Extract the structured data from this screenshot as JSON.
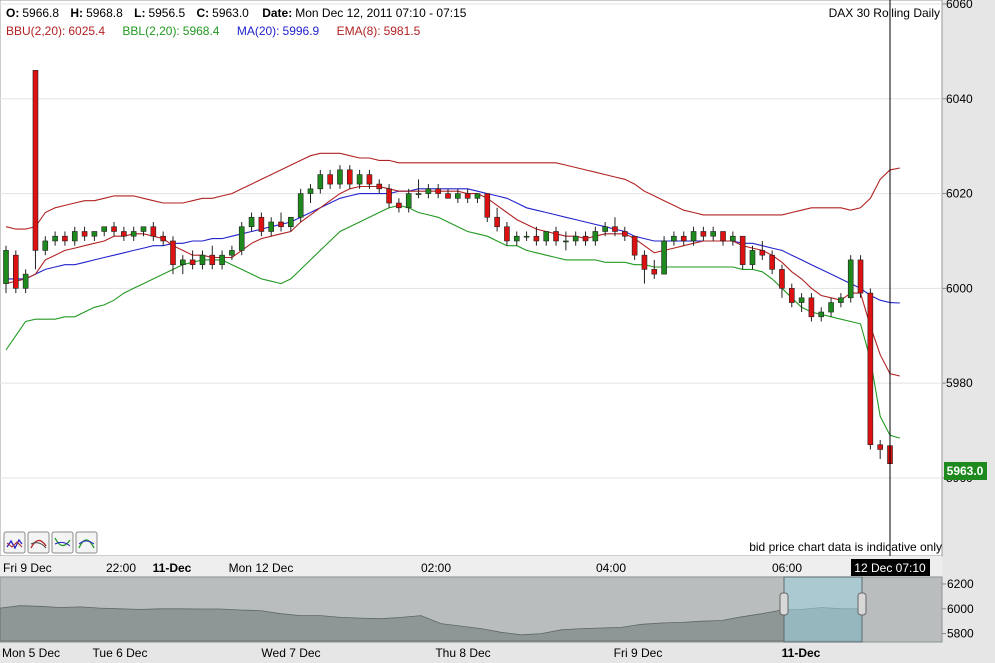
{
  "header": {
    "ohlc": [
      {
        "label": "O:",
        "value": "5966.8"
      },
      {
        "label": "H:",
        "value": "5968.8"
      },
      {
        "label": "L:",
        "value": "5956.5"
      },
      {
        "label": "C:",
        "value": "5963.0"
      }
    ],
    "date_label": "Date:",
    "date_value": "Mon Dec 12, 2011 07:10 - 07:15",
    "instrument": "DAX 30  Rolling Daily",
    "indicators": [
      {
        "label": "BBU(2,20):",
        "value": "6025.4",
        "color": "#b22222"
      },
      {
        "label": "BBL(2,20):",
        "value": "5968.4",
        "color": "#229922"
      },
      {
        "label": "MA(20):",
        "value": "5996.9",
        "color": "#2222cc"
      },
      {
        "label": "EMA(8):",
        "value": "5981.5",
        "color": "#b22222"
      }
    ]
  },
  "notice": "bid price chart data is indicative only",
  "last_price": "5963.0",
  "crosshair_label": "12 Dec 07:10",
  "toolbar_icons": [
    "chart-style-icon-1",
    "chart-style-icon-2",
    "chart-style-icon-3",
    "chart-style-icon-4"
  ],
  "colors": {
    "up": "#1e8a1e",
    "down": "#dd1111",
    "bbu": "#b22222",
    "bbl": "#229922",
    "ma": "#2222cc",
    "ema": "#b22222",
    "last_badge": "#1e8a1e"
  },
  "chart_data": {
    "type": "candlestick",
    "title": "DAX 30  Rolling Daily",
    "y_axis": {
      "side": "right",
      "range": [
        5945,
        6060
      ],
      "ticks": [
        5960,
        5980,
        6000,
        6020,
        6040,
        6060
      ]
    },
    "x_axis": {
      "labels": [
        {
          "text": "Fri 9 Dec",
          "bold": false
        },
        {
          "text": "22:00",
          "bold": false
        },
        {
          "text": "11-Dec",
          "bold": true
        },
        {
          "text": "Mon 12 Dec",
          "bold": false
        },
        {
          "text": "02:00",
          "bold": false
        },
        {
          "text": "04:00",
          "bold": false
        },
        {
          "text": "06:00",
          "bold": false
        }
      ]
    },
    "candles": [
      {
        "o": 6001,
        "h": 6009,
        "l": 5999,
        "c": 6008
      },
      {
        "o": 6007,
        "h": 6008,
        "l": 5999,
        "c": 6000
      },
      {
        "o": 6000,
        "h": 6004,
        "l": 5999,
        "c": 6003
      },
      {
        "o": 6046,
        "h": 6046,
        "l": 6004,
        "c": 6008
      },
      {
        "o": 6008,
        "h": 6011,
        "l": 6007,
        "c": 6010
      },
      {
        "o": 6010,
        "h": 6012,
        "l": 6009,
        "c": 6011
      },
      {
        "o": 6011,
        "h": 6012,
        "l": 6009,
        "c": 6010
      },
      {
        "o": 6010,
        "h": 6013,
        "l": 6009,
        "c": 6012
      },
      {
        "o": 6012,
        "h": 6013,
        "l": 6010,
        "c": 6011
      },
      {
        "o": 6011,
        "h": 6012,
        "l": 6010,
        "c": 6012
      },
      {
        "o": 6012,
        "h": 6013,
        "l": 6011,
        "c": 6013
      },
      {
        "o": 6013,
        "h": 6014,
        "l": 6011,
        "c": 6012
      },
      {
        "o": 6012,
        "h": 6013,
        "l": 6010,
        "c": 6011
      },
      {
        "o": 6011,
        "h": 6013,
        "l": 6010,
        "c": 6012
      },
      {
        "o": 6012,
        "h": 6013,
        "l": 6011,
        "c": 6013
      },
      {
        "o": 6013,
        "h": 6014,
        "l": 6010,
        "c": 6011
      },
      {
        "o": 6011,
        "h": 6012,
        "l": 6009,
        "c": 6010
      },
      {
        "o": 6010,
        "h": 6011,
        "l": 6003,
        "c": 6005
      },
      {
        "o": 6005,
        "h": 6007,
        "l": 6003,
        "c": 6006
      },
      {
        "o": 6006,
        "h": 6008,
        "l": 6004,
        "c": 6005
      },
      {
        "o": 6005,
        "h": 6008,
        "l": 6004,
        "c": 6007
      },
      {
        "o": 6007,
        "h": 6009,
        "l": 6004,
        "c": 6005
      },
      {
        "o": 6005,
        "h": 6008,
        "l": 6004,
        "c": 6007
      },
      {
        "o": 6007,
        "h": 6009,
        "l": 6006,
        "c": 6008
      },
      {
        "o": 6008,
        "h": 6014,
        "l": 6007,
        "c": 6013
      },
      {
        "o": 6013,
        "h": 6016,
        "l": 6012,
        "c": 6015
      },
      {
        "o": 6015,
        "h": 6016,
        "l": 6011,
        "c": 6012
      },
      {
        "o": 6012,
        "h": 6015,
        "l": 6011,
        "c": 6014
      },
      {
        "o": 6014,
        "h": 6016,
        "l": 6012,
        "c": 6013
      },
      {
        "o": 6013,
        "h": 6015,
        "l": 6012,
        "c": 6015
      },
      {
        "o": 6015,
        "h": 6021,
        "l": 6014,
        "c": 6020
      },
      {
        "o": 6020,
        "h": 6022,
        "l": 6018,
        "c": 6021
      },
      {
        "o": 6021,
        "h": 6025,
        "l": 6020,
        "c": 6024
      },
      {
        "o": 6024,
        "h": 6025,
        "l": 6021,
        "c": 6022
      },
      {
        "o": 6022,
        "h": 6026,
        "l": 6021,
        "c": 6025
      },
      {
        "o": 6025,
        "h": 6026,
        "l": 6021,
        "c": 6022
      },
      {
        "o": 6022,
        "h": 6025,
        "l": 6021,
        "c": 6024
      },
      {
        "o": 6024,
        "h": 6025,
        "l": 6021,
        "c": 6022
      },
      {
        "o": 6022,
        "h": 6023,
        "l": 6020,
        "c": 6021
      },
      {
        "o": 6021,
        "h": 6022,
        "l": 6017,
        "c": 6018
      },
      {
        "o": 6018,
        "h": 6019,
        "l": 6016,
        "c": 6017
      },
      {
        "o": 6017,
        "h": 6021,
        "l": 6016,
        "c": 6020
      },
      {
        "o": 6020,
        "h": 6023,
        "l": 6019,
        "c": 6020
      },
      {
        "o": 6020,
        "h": 6022,
        "l": 6019,
        "c": 6021
      },
      {
        "o": 6021,
        "h": 6022,
        "l": 6019,
        "c": 6020
      },
      {
        "o": 6020,
        "h": 6021,
        "l": 6019,
        "c": 6019
      },
      {
        "o": 6019,
        "h": 6021,
        "l": 6018,
        "c": 6020
      },
      {
        "o": 6020,
        "h": 6021,
        "l": 6018,
        "c": 6019
      },
      {
        "o": 6019,
        "h": 6020,
        "l": 6018,
        "c": 6020
      },
      {
        "o": 6020,
        "h": 6020,
        "l": 6014,
        "c": 6015
      },
      {
        "o": 6015,
        "h": 6017,
        "l": 6012,
        "c": 6013
      },
      {
        "o": 6013,
        "h": 6014,
        "l": 6009,
        "c": 6010
      },
      {
        "o": 6010,
        "h": 6012,
        "l": 6009,
        "c": 6011
      },
      {
        "o": 6011,
        "h": 6012,
        "l": 6010,
        "c": 6011
      },
      {
        "o": 6011,
        "h": 6013,
        "l": 6009,
        "c": 6010
      },
      {
        "o": 6010,
        "h": 6012,
        "l": 6009,
        "c": 6012
      },
      {
        "o": 6012,
        "h": 6013,
        "l": 6009,
        "c": 6010
      },
      {
        "o": 6010,
        "h": 6012,
        "l": 6008,
        "c": 6010
      },
      {
        "o": 6010,
        "h": 6012,
        "l": 6009,
        "c": 6011
      },
      {
        "o": 6011,
        "h": 6012,
        "l": 6009,
        "c": 6010
      },
      {
        "o": 6010,
        "h": 6013,
        "l": 6009,
        "c": 6012
      },
      {
        "o": 6012,
        "h": 6014,
        "l": 6011,
        "c": 6013
      },
      {
        "o": 6013,
        "h": 6015,
        "l": 6011,
        "c": 6012
      },
      {
        "o": 6012,
        "h": 6013,
        "l": 6010,
        "c": 6011
      },
      {
        "o": 6011,
        "h": 6011,
        "l": 6006,
        "c": 6007
      },
      {
        "o": 6007,
        "h": 6008,
        "l": 6001,
        "c": 6004
      },
      {
        "o": 6004,
        "h": 6006,
        "l": 6002,
        "c": 6003
      },
      {
        "o": 6003,
        "h": 6011,
        "l": 6003,
        "c": 6010
      },
      {
        "o": 6010,
        "h": 6012,
        "l": 6009,
        "c": 6011
      },
      {
        "o": 6011,
        "h": 6012,
        "l": 6009,
        "c": 6010
      },
      {
        "o": 6010,
        "h": 6013,
        "l": 6009,
        "c": 6012
      },
      {
        "o": 6012,
        "h": 6013,
        "l": 6010,
        "c": 6011
      },
      {
        "o": 6011,
        "h": 6013,
        "l": 6010,
        "c": 6012
      },
      {
        "o": 6012,
        "h": 6012,
        "l": 6009,
        "c": 6010
      },
      {
        "o": 6010,
        "h": 6012,
        "l": 6009,
        "c": 6011
      },
      {
        "o": 6011,
        "h": 6011,
        "l": 6004,
        "c": 6005
      },
      {
        "o": 6005,
        "h": 6009,
        "l": 6004,
        "c": 6008
      },
      {
        "o": 6008,
        "h": 6010,
        "l": 6006,
        "c": 6007
      },
      {
        "o": 6007,
        "h": 6008,
        "l": 6003,
        "c": 6004
      },
      {
        "o": 6004,
        "h": 6005,
        "l": 5998,
        "c": 6000
      },
      {
        "o": 6000,
        "h": 6001,
        "l": 5996,
        "c": 5997
      },
      {
        "o": 5997,
        "h": 5999,
        "l": 5995,
        "c": 5998
      },
      {
        "o": 5998,
        "h": 5999,
        "l": 5993,
        "c": 5994
      },
      {
        "o": 5994,
        "h": 5996,
        "l": 5993,
        "c": 5995
      },
      {
        "o": 5995,
        "h": 5998,
        "l": 5994,
        "c": 5997
      },
      {
        "o": 5997,
        "h": 5999,
        "l": 5996,
        "c": 5998
      },
      {
        "o": 5998,
        "h": 6007,
        "l": 5997,
        "c": 6006
      },
      {
        "o": 6006,
        "h": 6007,
        "l": 5998,
        "c": 5999
      },
      {
        "o": 5999,
        "h": 6000,
        "l": 5966,
        "c": 5967
      },
      {
        "o": 5967,
        "h": 5968,
        "l": 5964,
        "c": 5966
      },
      {
        "o": 5966.8,
        "h": 5968.8,
        "l": 5956.5,
        "c": 5963.0
      }
    ],
    "series": [
      {
        "name": "BBU(2,20)",
        "color": "#b22222",
        "values": [
          6013,
          6012.5,
          6012.5,
          6013,
          6016,
          6017,
          6017.5,
          6018,
          6018.5,
          6018.5,
          6019,
          6019.5,
          6019.5,
          6019.5,
          6019,
          6018.5,
          6018,
          6018,
          6018,
          6018.5,
          6019,
          6019,
          6019.5,
          6020,
          6021,
          6022,
          6023,
          6024,
          6025,
          6026,
          6027,
          6028,
          6028.5,
          6028.5,
          6028.5,
          6028,
          6027.5,
          6027.5,
          6027,
          6027,
          6026.5,
          6026.5,
          6026.5,
          6026.5,
          6026.5,
          6026.5,
          6026.5,
          6026.5,
          6026.5,
          6026.5,
          6026.5,
          6026.5,
          6026.5,
          6026.5,
          6026.5,
          6026.5,
          6026.5,
          6026,
          6025.5,
          6025,
          6024.5,
          6024,
          6023.5,
          6023,
          6022,
          6020.5,
          6019.5,
          6018.5,
          6017.5,
          6016.5,
          6016,
          6015.5,
          6015.5,
          6015.5,
          6015.5,
          6015.5,
          6015.5,
          6015.5,
          6015.5,
          6015.5,
          6016,
          6016.5,
          6017,
          6017,
          6017,
          6017,
          6016.5,
          6017,
          6019,
          6023,
          6025,
          6025.4
        ]
      },
      {
        "name": "MA(20)",
        "color": "#2222cc",
        "values": [
          6002,
          6002,
          6002,
          6003,
          6004,
          6004.5,
          6005,
          6005,
          6005.5,
          6006,
          6006.5,
          6007,
          6007.5,
          6008,
          6008.5,
          6009,
          6009,
          6009.5,
          6009.5,
          6010,
          6010,
          6010.5,
          6010.5,
          6011,
          6011.5,
          6012,
          6012.5,
          6013,
          6013.5,
          6014,
          6015,
          6016,
          6017,
          6018,
          6019,
          6019.5,
          6020,
          6020,
          6020,
          6020,
          6020.5,
          6020.5,
          6021,
          6021,
          6021,
          6021,
          6021,
          6021,
          6020.5,
          6020,
          6019.5,
          6019,
          6018,
          6017,
          6016.5,
          6016,
          6015.5,
          6015,
          6014.5,
          6014,
          6013.5,
          6013,
          6012.5,
          6012,
          6011,
          6010.5,
          6010,
          6010,
          6010,
          6010,
          6010,
          6010,
          6010,
          6010,
          6010,
          6009.5,
          6009.5,
          6009,
          6008.5,
          6008,
          6007,
          6006,
          6005,
          6004,
          6003,
          6002,
          6001,
          6000,
          5998.5,
          5997.5,
          5997,
          5996.9
        ]
      },
      {
        "name": "BBL(2,20)",
        "color": "#229922",
        "values": [
          5987,
          5990,
          5993,
          5993.5,
          5993.5,
          5993.5,
          5994,
          5994,
          5995,
          5996,
          5996.5,
          5997.5,
          5999,
          6000,
          6001,
          6002,
          6003,
          6004,
          6005,
          6005.5,
          6006,
          6006,
          6006,
          6005,
          6004,
          6003,
          6002,
          6001.5,
          6001,
          6002,
          6004,
          6006,
          6008,
          6010,
          6012,
          6013,
          6014,
          6015,
          6016,
          6017,
          6017.5,
          6017,
          6016,
          6015.5,
          6015,
          6014,
          6013,
          6012,
          6011.5,
          6011,
          6010,
          6009,
          6009,
          6008,
          6007.5,
          6007,
          6006.5,
          6006,
          6006,
          6006,
          6006,
          6005.5,
          6005.5,
          6005.5,
          6005,
          6005,
          6004.5,
          6004.5,
          6004.5,
          6004.5,
          6004.5,
          6004.5,
          6004.5,
          6004.5,
          6004.5,
          6004,
          6004,
          6003.5,
          6002,
          6000,
          5998,
          5996,
          5995,
          5994.5,
          5994,
          5993.5,
          5993,
          5992.5,
          5985,
          5973,
          5969,
          5968.4
        ]
      },
      {
        "name": "EMA(8)",
        "color": "#b22222",
        "values": [
          6001,
          6001.5,
          6002,
          6003,
          6006,
          6007,
          6008,
          6008.5,
          6009,
          6009.5,
          6010,
          6011,
          6011,
          6011.5,
          6011.5,
          6011,
          6010.5,
          6009,
          6008,
          6007,
          6007,
          6006.5,
          6006.5,
          6006.5,
          6008,
          6009.5,
          6010.5,
          6011,
          6011.5,
          6012,
          6014,
          6015.5,
          6017,
          6018.5,
          6020,
          6021,
          6021.5,
          6021.5,
          6021.5,
          6021,
          6020.5,
          6020.5,
          6020.5,
          6020.5,
          6020.5,
          6020.5,
          6020.5,
          6020,
          6020,
          6019,
          6017.5,
          6016,
          6014.5,
          6013.5,
          6012.5,
          6012,
          6011.5,
          6011,
          6011,
          6010.5,
          6011,
          6011.5,
          6011.5,
          6011.5,
          6010.5,
          6009,
          6007.5,
          6008,
          6008.5,
          6009,
          6009.5,
          6010,
          6010,
          6010,
          6010,
          6009,
          6008.5,
          6008,
          6007,
          6005.5,
          6003.5,
          6002,
          6000,
          5998.5,
          5998,
          5997.5,
          5999,
          5999,
          5992,
          5986,
          5982,
          5981.5
        ]
      }
    ]
  },
  "navigator": {
    "labels": [
      "Mon 5 Dec",
      "Tue 6 Dec",
      "Wed 7 Dec",
      "Thu 8 Dec",
      "Fri 9 Dec",
      "11-Dec"
    ],
    "y_ticks": [
      "6200",
      "6000",
      "5800"
    ],
    "y_range": [
      5740,
      6240
    ],
    "values": [
      6005,
      6025,
      6020,
      6010,
      6015,
      6005,
      6000,
      5995,
      6000,
      6000,
      5998,
      5998,
      5990,
      5985,
      5960,
      5945,
      5945,
      5930,
      5925,
      5920,
      5930,
      5945,
      5880,
      5860,
      5840,
      5810,
      5790,
      5800,
      5830,
      5840,
      5845,
      5850,
      5875,
      5885,
      5890,
      5900,
      5905,
      5935,
      5960,
      5990,
      5995,
      6010,
      6000,
      6000
    ]
  }
}
